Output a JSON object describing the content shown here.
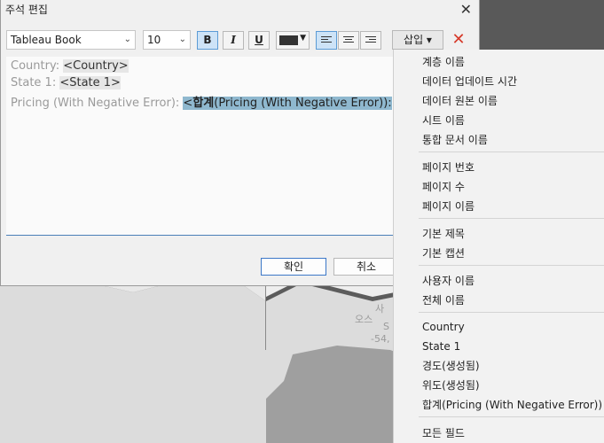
{
  "dialog": {
    "title": "주석 편집",
    "close_icon": "close-icon"
  },
  "toolbar": {
    "font_family": "Tableau Book",
    "font_size": "10",
    "bold_label": "B",
    "italic_label": "I",
    "underline_label": "U",
    "text_color": "#333333",
    "insert_label": "삽입 ▾",
    "clear_icon": "clear-x-icon"
  },
  "editor": {
    "line1_label": "Country: ",
    "line1_field": "<Country>",
    "line2_label": "State 1: ",
    "line2_field": "<State 1>",
    "line3_label": "Pricing (With Negative Error): ",
    "line3_field_prefix": "<",
    "line3_field_bold": "합계",
    "line3_field_rest": "(Pricing (With Negative Error)):"
  },
  "buttons": {
    "ok": "확인",
    "cancel": "취소"
  },
  "menu": {
    "group1": [
      "계층 이름",
      "데이터 업데이트 시간",
      "데이터 원본 이름",
      "시트 이름",
      "통합 문서 이름"
    ],
    "group2": [
      "페이지 번호",
      "페이지 수",
      "페이지 이름"
    ],
    "group3": [
      "기본 제목",
      "기본 캡션"
    ],
    "group4": [
      "사용자 이름",
      "전체 이름"
    ],
    "group5": [
      "Country",
      "State 1",
      "경도(생성됨)",
      "위도(생성됨)",
      "합계(Pricing (With Negative Error))"
    ],
    "group6": [
      "모든 필드"
    ]
  },
  "map": {
    "label1": "사",
    "label2": "오스",
    "label3": "S",
    "label4": "-54,"
  }
}
